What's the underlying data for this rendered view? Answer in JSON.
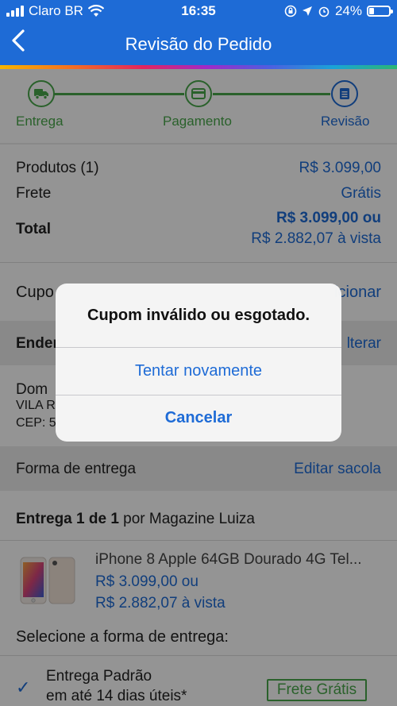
{
  "status_bar": {
    "carrier": "Claro BR",
    "time": "16:35",
    "battery": "24%",
    "battery_level": 0.24
  },
  "header": {
    "title": "Revisão do Pedido"
  },
  "steps": [
    {
      "label": "Entrega"
    },
    {
      "label": "Pagamento"
    },
    {
      "label": "Revisão"
    }
  ],
  "summary": {
    "products_label": "Produtos (1)",
    "products_value": "R$ 3.099,00",
    "shipping_label": "Frete",
    "shipping_value": "Grátis",
    "total_label": "Total",
    "total_line1": "R$ 3.099,00 ou",
    "total_line2": "R$ 2.882,07 à vista"
  },
  "coupon": {
    "label": "Cupo",
    "action": "icionar"
  },
  "address": {
    "section_label": "Ender",
    "action": "lterar",
    "name": "Dom",
    "line1": "VILA R",
    "cep": "CEP: 5"
  },
  "delivery_form": {
    "label": "Forma de entrega",
    "action": "Editar sacola"
  },
  "shipment": {
    "title_bold": "Entrega 1 de 1",
    "title_rest": " por Magazine Luiza",
    "product_name": "iPhone 8 Apple 64GB Dourado 4G Tel...",
    "price_line1": "R$ 3.099,00 ou",
    "price_line2": "R$ 2.882,07 à vista"
  },
  "delivery_options": {
    "heading": "Selecione a forma de entrega:",
    "option_name": "Entrega Padrão",
    "option_time": "em até 14 dias úteis*",
    "option_badge": "Frete Grátis"
  },
  "alert": {
    "message": "Cupom inválido ou esgotado.",
    "retry": "Tentar novamente",
    "cancel": "Cancelar"
  },
  "colors": {
    "brand_blue": "#1e6bd6",
    "step_green": "#49a84b",
    "step_blue": "#1e6bd6"
  }
}
